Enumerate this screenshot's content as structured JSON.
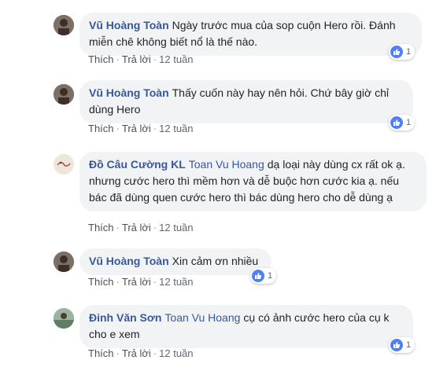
{
  "labels": {
    "like": "Thích",
    "reply": "Trả lời"
  },
  "comments": [
    {
      "author": "Vũ Hoàng Toàn",
      "mention": "",
      "text": "Ngày trước mua của sop cuộn Hero rồi. Đánh miễn chê không biết nổ là thế nào.",
      "time": "12 tuần",
      "likes": "1",
      "avatar_color": "#7d6f64"
    },
    {
      "author": "Vũ Hoàng Toàn",
      "mention": "",
      "text": "Thấy cuốn này hay nên hỏi. Chứ bây giờ chỉ dùng Hero",
      "time": "12 tuần",
      "likes": "1",
      "avatar_color": "#7d6f64"
    },
    {
      "author": "Đồ Câu Cường KL",
      "mention": "Toan Vu Hoang",
      "text": "dạ loại này dùng cx rất ok ạ. nhưng cước hero thì mềm hơn và dễ buộc hơn cước kia ạ. nếu bác đã dùng quen cước hero thì bác dùng hero cho dễ dùng ạ",
      "time": "12 tuần",
      "likes": "",
      "avatar_color": "#e9e2d6"
    },
    {
      "author": "Vũ Hoàng Toàn",
      "mention": "",
      "text": "Xin cảm ơn nhiều",
      "time": "12 tuần",
      "likes": "1",
      "avatar_color": "#7d6f64"
    },
    {
      "author": "Đinh Văn Sơn",
      "mention": "Toan Vu Hoang",
      "text": "cụ có ảnh cước hero của cụ k cho e xem",
      "time": "12 tuần",
      "likes": "1",
      "avatar_color": "#7a9a7e"
    }
  ]
}
